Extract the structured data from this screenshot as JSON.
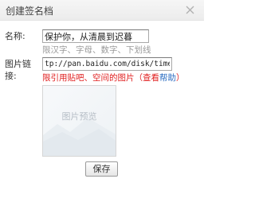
{
  "dialog": {
    "title": "创建签名档",
    "close_icon": "close-icon"
  },
  "form": {
    "name_label": "名称:",
    "name_value": "保护你，从清晨到迟暮",
    "name_hint": "限汉字、字母、数字、下划线",
    "url_label_line1": "图片链",
    "url_label_line2": "接:",
    "url_value": "tp://pan.baidu.com/disk/timeline",
    "url_warning": "限引用贴吧、空间的图片（查看",
    "url_help_link": "帮助",
    "url_warning_end": "）",
    "warning_color": "#e02020",
    "link_color": "#2b6dc2"
  },
  "preview": {
    "label": "图片预览",
    "icon": "image-placeholder-icon"
  },
  "actions": {
    "save_label": "保存"
  }
}
